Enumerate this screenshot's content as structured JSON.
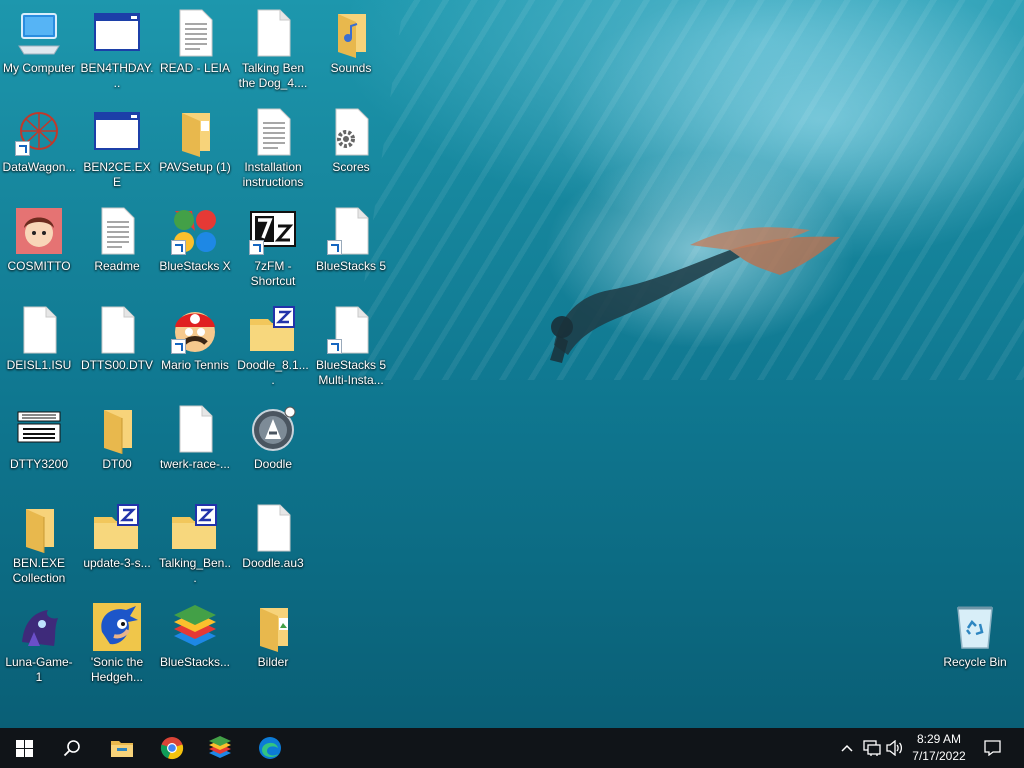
{
  "desktop": {
    "icons": [
      {
        "label": "My Computer"
      },
      {
        "label": "BEN4THDAY..."
      },
      {
        "label": "READ - LEIA"
      },
      {
        "label": "Talking Ben the Dog_4...."
      },
      {
        "label": "Sounds"
      },
      {
        "label": "DataWagon..."
      },
      {
        "label": "BEN2CE.EXE"
      },
      {
        "label": "PAVSetup (1)"
      },
      {
        "label": "Installation instructions"
      },
      {
        "label": "Scores"
      },
      {
        "label": "COSMITTO"
      },
      {
        "label": "Readme"
      },
      {
        "label": "BlueStacks X"
      },
      {
        "label": "7zFM - Shortcut"
      },
      {
        "label": "BlueStacks 5"
      },
      {
        "label": "DEISL1.ISU"
      },
      {
        "label": "DTTS00.DTV"
      },
      {
        "label": "Mario Tennis"
      },
      {
        "label": "Doodle_8.1...."
      },
      {
        "label": "BlueStacks 5 Multi-Insta..."
      },
      {
        "label": "DTTY3200"
      },
      {
        "label": "DT00"
      },
      {
        "label": "twerk-race-..."
      },
      {
        "label": "Doodle"
      },
      {
        "label": "BEN.EXE Collection"
      },
      {
        "label": "update-3-s..."
      },
      {
        "label": "Talking_Ben..."
      },
      {
        "label": "Doodle.au3"
      },
      {
        "label": "Luna-Game-1"
      },
      {
        "label": "'Sonic the Hedgeh..."
      },
      {
        "label": "BlueStacks..."
      },
      {
        "label": "Bilder"
      },
      {
        "label": "Recycle Bin"
      }
    ]
  },
  "taskbar": {
    "clock_time": "8:29 AM",
    "clock_date": "7/17/2022",
    "colors": {
      "background": "#101418",
      "accent": "#3b8fe0"
    }
  }
}
